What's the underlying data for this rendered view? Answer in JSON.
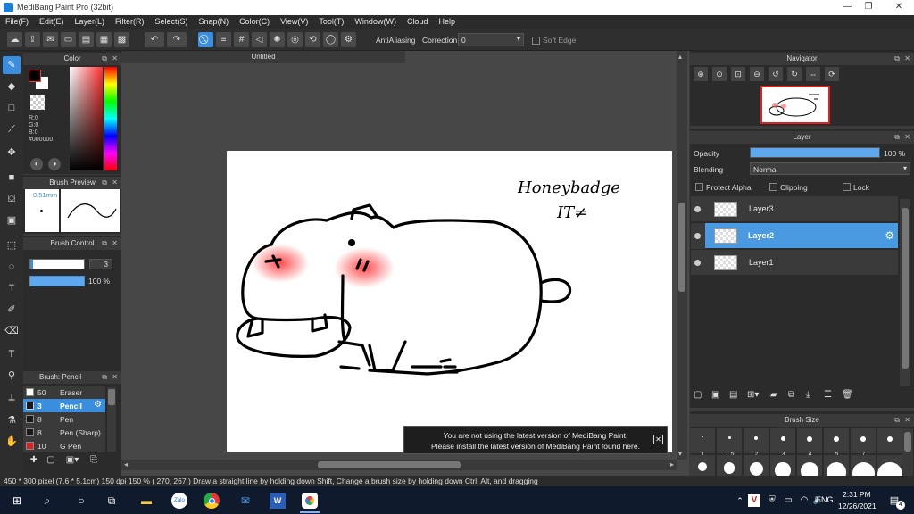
{
  "window": {
    "title": "MediBang Paint Pro (32bit)",
    "controls": [
      "—",
      "❐",
      "✕"
    ]
  },
  "menu": [
    "File(F)",
    "Edit(E)",
    "Layer(L)",
    "Filter(R)",
    "Select(S)",
    "Snap(N)",
    "Color(C)",
    "View(V)",
    "Tool(T)",
    "Window(W)",
    "Cloud",
    "Help"
  ],
  "toolbar": {
    "antialiasing_label": "AntiAliasing",
    "correction_label": "Correction",
    "correction_value": "0",
    "soft_edge_label": "Soft Edge"
  },
  "color_panel": {
    "title": "Color",
    "r": "R:0",
    "g": "G:0",
    "b": "B:0",
    "hex": "#000000"
  },
  "brush_preview": {
    "title": "Brush Preview",
    "size": "0.51mm"
  },
  "brush_control": {
    "title": "Brush Control",
    "size": "3",
    "opacity": "100 %"
  },
  "brush_list": {
    "title": "Brush: Pencil",
    "items": [
      {
        "size": "50",
        "name": "Eraser",
        "color": "#ffffff"
      },
      {
        "size": "3",
        "name": "Pencil",
        "color": "#1a1a1a"
      },
      {
        "size": "8",
        "name": "Pen",
        "color": "#1a1a1a"
      },
      {
        "size": "8",
        "name": "Pen (Sharp)",
        "color": "#1a1a1a"
      },
      {
        "size": "10",
        "name": "G Pen",
        "color": "#e02020"
      }
    ]
  },
  "document": {
    "tab": "Untitled",
    "drawing_text_line1": "Honeybadge",
    "drawing_text_line2": "IT≠"
  },
  "notice": {
    "line1": "You are not using the latest version of MediBang Paint.",
    "line2": "Please install the latest version of MediBang Paint found here.",
    "close": "✕"
  },
  "navigator": {
    "title": "Navigator"
  },
  "layer_panel": {
    "title": "Layer",
    "opacity_label": "Opacity",
    "opacity_value": "100 %",
    "opacity_fraction": 1.0,
    "blending_label": "Blending",
    "blending_value": "Normal",
    "protect_alpha": "Protect Alpha",
    "clipping": "Clipping",
    "lock": "Lock",
    "layers": [
      {
        "name": "Layer3"
      },
      {
        "name": "Layer2"
      },
      {
        "name": "Layer1"
      }
    ]
  },
  "brush_size": {
    "title": "Brush Size",
    "sizes": [
      "1",
      "1.5",
      "2",
      "3",
      "4",
      "5",
      "7"
    ]
  },
  "status": {
    "text": "450 * 300 pixel   (7.6 * 5.1cm)   150 dpi   150 %   ( 270, 267 )   Draw a straight line by holding down Shift, Change a brush size by holding down Ctrl, Alt, and dragging"
  },
  "taskbar": {
    "ime": "ENG",
    "time": "2:31 PM",
    "date": "12/26/2021",
    "notifications": "4"
  }
}
